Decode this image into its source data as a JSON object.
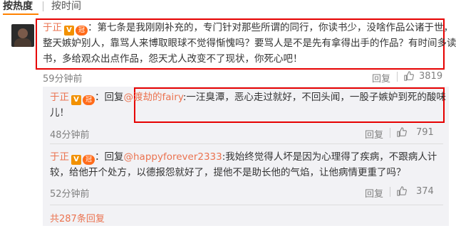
{
  "sort": {
    "hot": "按热度",
    "time": "按时间"
  },
  "main_comment": {
    "username": "于正",
    "separator": "：",
    "text_lines": [
      "第七条是我刚刚补充的，专门针对那些所谓的同行，你读书少，没啥作品公诸于世，",
      "整天嫉妒别人，靠骂人来博取眼球不觉得惭愧吗？要骂人是不是先有拿得出手的作品？有时间多读",
      "书，多给观众出点作品，怨天尤人改变不了现状，你死心吧！"
    ],
    "time": "59分钟前",
    "reply_label": "回复",
    "likes": "3819"
  },
  "replies": [
    {
      "username": "于正",
      "prefix": "：回复",
      "mention": "@渡劫的fairy",
      "line1": ":一汪臭潭，恶心走过就好，不回头闻，一股子嫉妒到死的酸味",
      "line2": "儿！",
      "time": "48分钟前",
      "reply_label": "回复",
      "likes": "791"
    },
    {
      "username": "于正",
      "prefix": "：回复",
      "mention": "@happyforever2333",
      "line1": ":我始终觉得人坏是因为心理得了疾病，不跟病人计",
      "line2": "较，给他开个处方，以德报怨就好了，提他不是助长他的气焰，让他病情更重了吗？",
      "time": "52分钟前",
      "reply_label": "回复",
      "likes": "374"
    }
  ],
  "more_replies": "共287条回复",
  "badges": {
    "verified": "V",
    "level": "冠"
  },
  "icons": {
    "like": "thumbs-up-icon",
    "verified": "verified-v-icon",
    "level": "level-badge-icon"
  },
  "colors": {
    "username": "#eb7350",
    "highlight_box": "#e60000",
    "sort_underline": "#ff8200",
    "reply_bg": "#f2f2f5"
  }
}
